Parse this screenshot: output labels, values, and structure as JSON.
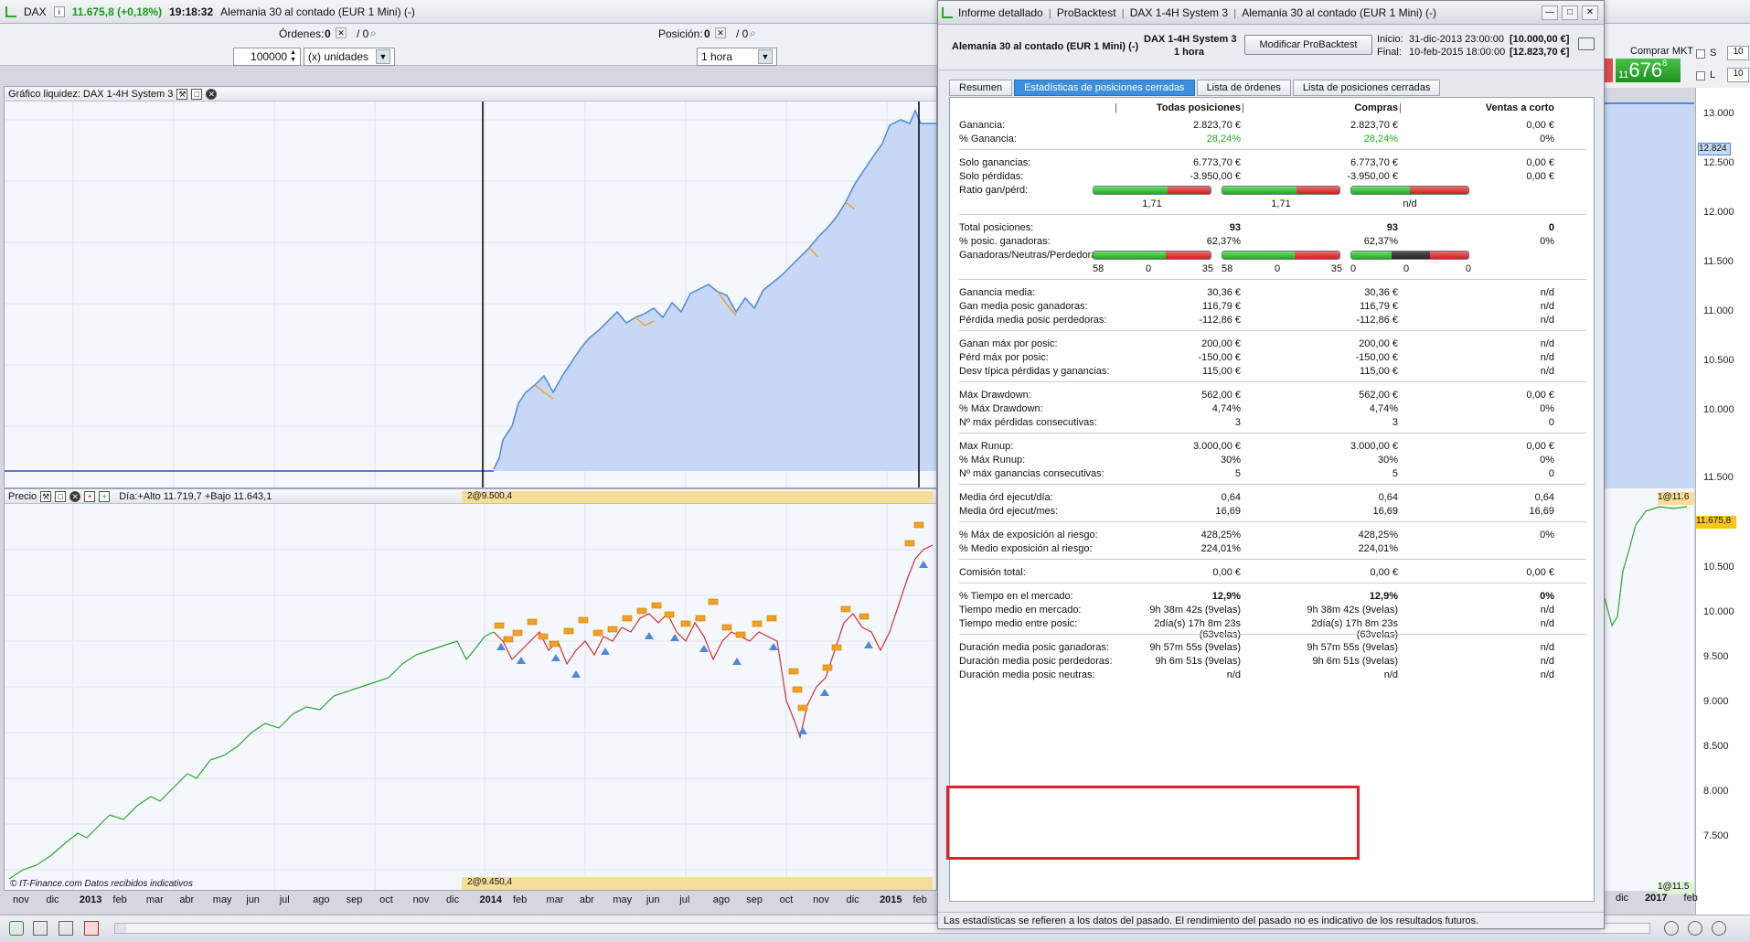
{
  "topbar": {
    "symbol": "DAX",
    "price": "11.675,8 (+0,18%)",
    "time": "19:18:32",
    "instrument": "Alemania 30 al contado (EUR 1 Mini) (-)"
  },
  "orders": {
    "ordenes_label": "Órdenes:",
    "ordenes_value": "0",
    "ordenes_slash": "/ 0",
    "posicion_label": "Posición:",
    "posicion_value": "0",
    "posicion_slash": "/ 0",
    "qty_value": "100000",
    "units_value": "(x) unidades",
    "timeframe_value": "1 hora"
  },
  "equity_pane": {
    "title": "Gráfico liquidez: DAX 1-4H System 3"
  },
  "price_pane": {
    "title": "Precio",
    "day_info": "Día:+Alto 11.719,7 +Bajo 11.643,1",
    "marker_top": "2@9.500,4",
    "marker_bottom": "2@9.450,4",
    "credit": "© IT-Finance.com Datos recibidos indicativos"
  },
  "time_axis": [
    {
      "label": "nov",
      "bold": false
    },
    {
      "label": "dic",
      "bold": false
    },
    {
      "label": "2013",
      "bold": true
    },
    {
      "label": "feb",
      "bold": false
    },
    {
      "label": "mar",
      "bold": false
    },
    {
      "label": "abr",
      "bold": false
    },
    {
      "label": "may",
      "bold": false
    },
    {
      "label": "jun",
      "bold": false
    },
    {
      "label": "jul",
      "bold": false
    },
    {
      "label": "ago",
      "bold": false
    },
    {
      "label": "sep",
      "bold": false
    },
    {
      "label": "oct",
      "bold": false
    },
    {
      "label": "nov",
      "bold": false
    },
    {
      "label": "dic",
      "bold": false
    },
    {
      "label": "2014",
      "bold": true
    },
    {
      "label": "feb",
      "bold": false
    },
    {
      "label": "mar",
      "bold": false
    },
    {
      "label": "abr",
      "bold": false
    },
    {
      "label": "may",
      "bold": false
    },
    {
      "label": "jun",
      "bold": false
    },
    {
      "label": "jul",
      "bold": false
    },
    {
      "label": "ago",
      "bold": false
    },
    {
      "label": "sep",
      "bold": false
    },
    {
      "label": "oct",
      "bold": false
    },
    {
      "label": "nov",
      "bold": false
    },
    {
      "label": "dic",
      "bold": false
    },
    {
      "label": "2015",
      "bold": true
    },
    {
      "label": "feb",
      "bold": false
    }
  ],
  "right_panel": {
    "buy_label": "Comprar MKT",
    "buy_price_small": "11",
    "buy_price_big": "676",
    "buy_price_sup": "8",
    "s_label": "S",
    "l_label": "L",
    "s_value": "10",
    "l_value": "10",
    "equity_axis": [
      "13.000",
      "12.500",
      "12.000",
      "11.500",
      "11.000",
      "10.500",
      "10.000"
    ],
    "equity_flag": "12.824",
    "price_axis": [
      "11.500",
      "11.000",
      "10.500",
      "10.000",
      "9.500",
      "9.000",
      "8.500",
      "8.000",
      "7.500"
    ],
    "price_flag": "11.675,8",
    "bottom_axis": [
      "dic",
      "2017",
      "feb"
    ],
    "marker_right_top": "1@11.6",
    "marker_right_bottom": "1@11.5"
  },
  "dialog": {
    "title_items": [
      "Informe detallado",
      "ProBacktest",
      "DAX 1-4H System 3",
      "Alemania 30 al contado (EUR 1 Mini) (-)"
    ],
    "instrument": "Alemania 30 al contado (EUR 1 Mini) (-)",
    "system": "DAX 1-4H System 3",
    "timeframe": "1 hora",
    "modify_button": "Modificar ProBacktest",
    "inicio_label": "Inicio:",
    "inicio_value": "31-dic-2013 23:00:00",
    "inicio_capital": "[10.000,00 €]",
    "final_label": "Final:",
    "final_value": "10-feb-2015 18:00:00",
    "final_capital": "[12.823,70 €]",
    "tabs": [
      "Resumen",
      "Estadísticas de posiciones cerradas",
      "Lista de órdenes",
      "Lista de posiciones cerradas"
    ],
    "columns": [
      "Todas posiciones",
      "Compras",
      "Ventas a corto"
    ],
    "footer": "Las estadísticas se refieren a los datos del pasado. El rendimiento del pasado no es indicativo de los resultados futuros.",
    "rows": [
      {
        "label": "Ganancia:",
        "v": [
          "2.823,70 €",
          "2.823,70 €",
          "0,00 €"
        ]
      },
      {
        "label": "% Ganancia:",
        "v": [
          "28,24%",
          "28,24%",
          "0%"
        ],
        "green": true
      },
      {
        "sep": true
      },
      {
        "label": "Solo ganancias:",
        "v": [
          "6.773,70 €",
          "6.773,70 €",
          "0,00 €"
        ]
      },
      {
        "label": "Solo pérdidas:",
        "v": [
          "-3.950,00 €",
          "-3.950,00 €",
          "0,00 €"
        ]
      },
      {
        "label": "Ratio gan/pérd:",
        "bar": "ratio"
      },
      {
        "label": "",
        "center": [
          "1,71",
          "1,71",
          "n/d"
        ]
      },
      {
        "sep": true
      },
      {
        "label": "Total posiciones:",
        "v": [
          "93",
          "93",
          "0"
        ],
        "bold": true
      },
      {
        "label": "% posic. ganadoras:",
        "v": [
          "62,37%",
          "62,37%",
          "0%"
        ]
      },
      {
        "label": "Ganadoras/Neutras/Perdedoras:",
        "bar": "gnp"
      },
      {
        "label": "",
        "triples": [
          [
            "58",
            "0",
            "35"
          ],
          [
            "58",
            "0",
            "35"
          ],
          [
            "0",
            "0",
            "0"
          ]
        ]
      },
      {
        "sep": true
      },
      {
        "label": "Ganancia media:",
        "v": [
          "30,36 €",
          "30,36 €",
          "n/d"
        ]
      },
      {
        "label": "Gan media posic ganadoras:",
        "v": [
          "116,79 €",
          "116,79 €",
          "n/d"
        ]
      },
      {
        "label": "Pérdida media posic perdedoras:",
        "v": [
          "-112,86 €",
          "-112,86 €",
          "n/d"
        ]
      },
      {
        "sep": true
      },
      {
        "label": "Ganan máx por posic:",
        "v": [
          "200,00 €",
          "200,00 €",
          "n/d"
        ]
      },
      {
        "label": "Pérd máx por posic:",
        "v": [
          "-150,00 €",
          "-150,00 €",
          "n/d"
        ]
      },
      {
        "label": "Desv típica pérdidas y ganancias:",
        "v": [
          "115,00 €",
          "115,00 €",
          "n/d"
        ]
      },
      {
        "sep": true
      },
      {
        "label": "Máx Drawdown:",
        "v": [
          "562,00 €",
          "562,00 €",
          "0,00 €"
        ]
      },
      {
        "label": "% Máx Drawdown:",
        "v": [
          "4,74%",
          "4,74%",
          "0%"
        ]
      },
      {
        "label": "Nº máx pérdidas consecutivas:",
        "v": [
          "3",
          "3",
          "0"
        ]
      },
      {
        "sep": true
      },
      {
        "label": "Max Runup:",
        "v": [
          "3.000,00 €",
          "3.000,00 €",
          "0,00 €"
        ]
      },
      {
        "label": "% Máx Runup:",
        "v": [
          "30%",
          "30%",
          "0%"
        ]
      },
      {
        "label": "Nº máx ganancias consecutivas:",
        "v": [
          "5",
          "5",
          "0"
        ]
      },
      {
        "sep": true
      },
      {
        "label": "Media órd ejecut/día:",
        "v": [
          "0,64",
          "0,64",
          "0,64"
        ]
      },
      {
        "label": "Media órd ejecut/mes:",
        "v": [
          "16,69",
          "16,69",
          "16,69"
        ]
      },
      {
        "sep": true
      },
      {
        "label": "% Máx de exposición al riesgo:",
        "v": [
          "428,25%",
          "428,25%",
          "0%"
        ]
      },
      {
        "label": "% Medio exposición al riesgo:",
        "v": [
          "224,01%",
          "224,01%",
          ""
        ]
      },
      {
        "sep": true
      },
      {
        "label": "Comisión total:",
        "v": [
          "0,00 €",
          "0,00 €",
          "0,00 €"
        ]
      },
      {
        "sep": true
      },
      {
        "label": "% Tiempo en el mercado:",
        "v": [
          "12,9%",
          "12,9%",
          "0%"
        ],
        "bold": true
      },
      {
        "label": "Tiempo medio en mercado:",
        "v": [
          "9h 38m 42s (9velas)",
          "9h 38m 42s (9velas)",
          "n/d"
        ]
      },
      {
        "label": "Tiempo medio entre posic:",
        "v": [
          "2día(s) 17h 8m 23s (63velas)",
          "2día(s) 17h 8m 23s (63velas)",
          "n/d"
        ]
      },
      {
        "sep": true
      },
      {
        "label": "Duración media posic ganadoras:",
        "v": [
          "9h 57m 55s (9velas)",
          "9h 57m 55s (9velas)",
          "n/d"
        ]
      },
      {
        "label": "Duración media posic perdedoras:",
        "v": [
          "9h 6m 51s (9velas)",
          "9h 6m 51s (9velas)",
          "n/d"
        ]
      },
      {
        "label": "Duración media posic neutras:",
        "v": [
          "n/d",
          "n/d",
          "n/d"
        ]
      }
    ]
  },
  "colors": {
    "accent": "#3d8ee0",
    "equity_fill": "#c6d8f6",
    "equity_line": "#4f86e0",
    "equity_orange": "#f0a030",
    "gain": "#22aa22",
    "loss": "#c81f1f",
    "highlight": "#e0202a"
  }
}
